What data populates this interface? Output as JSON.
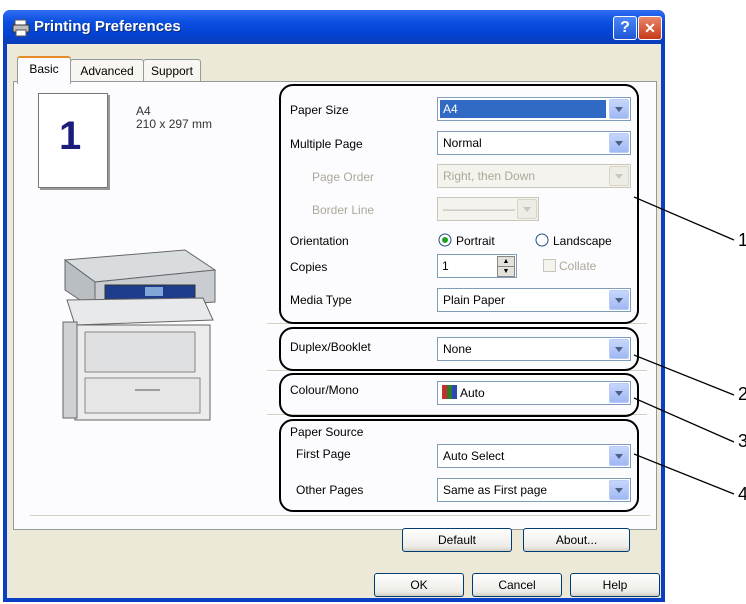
{
  "window": {
    "title": "Printing Preferences",
    "help_btn": "?",
    "close_btn": "✕"
  },
  "tabs": [
    {
      "label": "Basic"
    },
    {
      "label": "Advanced"
    },
    {
      "label": "Support"
    }
  ],
  "preview": {
    "number": "1",
    "paper": "A4",
    "dims": "210 x 297 mm"
  },
  "settings": {
    "paper_size": {
      "label": "Paper Size",
      "value": "A4"
    },
    "multiple_page": {
      "label": "Multiple Page",
      "value": "Normal"
    },
    "page_order": {
      "label": "Page Order",
      "value": "Right, then Down"
    },
    "border_line": {
      "label": "Border Line",
      "value": "——————"
    },
    "orientation": {
      "label": "Orientation",
      "portrait": "Portrait",
      "landscape": "Landscape",
      "selected": "Portrait"
    },
    "copies": {
      "label": "Copies",
      "value": "1",
      "collate": "Collate"
    },
    "media_type": {
      "label": "Media Type",
      "value": "Plain Paper"
    },
    "duplex": {
      "label": "Duplex/Booklet",
      "value": "None"
    },
    "colour": {
      "label": "Colour/Mono",
      "value": "Auto"
    },
    "paper_source": {
      "label": "Paper Source",
      "first_page": {
        "label": "First Page",
        "value": "Auto Select"
      },
      "other_pages": {
        "label": "Other Pages",
        "value": "Same as First page"
      }
    }
  },
  "buttons": {
    "default": "Default",
    "about": "About...",
    "ok": "OK",
    "cancel": "Cancel",
    "help": "Help"
  },
  "callouts": [
    "1",
    "2",
    "3",
    "4"
  ]
}
